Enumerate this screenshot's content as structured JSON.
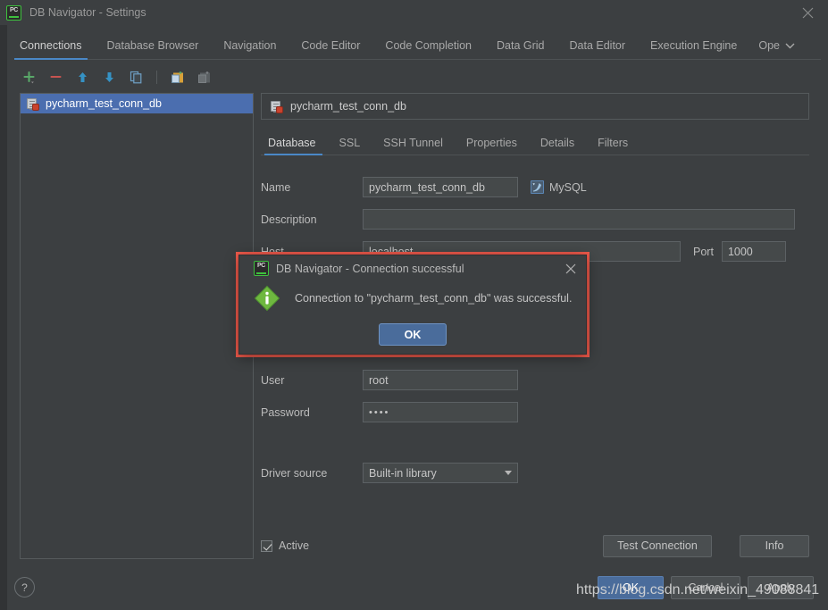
{
  "window": {
    "title": "DB Navigator - Settings",
    "logo_icon": "pycharm-pc-logo",
    "logo_text": "PC",
    "close_icon": "close-icon"
  },
  "tabs": [
    {
      "label": "Connections",
      "active": true
    },
    {
      "label": "Database Browser",
      "active": false
    },
    {
      "label": "Navigation",
      "active": false
    },
    {
      "label": "Code Editor",
      "active": false
    },
    {
      "label": "Code Completion",
      "active": false
    },
    {
      "label": "Data Grid",
      "active": false
    },
    {
      "label": "Data Editor",
      "active": false
    },
    {
      "label": "Execution Engine",
      "active": false
    },
    {
      "label": "Ope",
      "active": false
    }
  ],
  "tabs_overflow_icon": "chevron-down-icon",
  "toolbar": {
    "buttons": [
      {
        "name": "add-connection-button",
        "icon": "plus-icon"
      },
      {
        "name": "remove-connection-button",
        "icon": "minus-icon"
      },
      {
        "name": "move-up-button",
        "icon": "arrow-up-icon"
      },
      {
        "name": "move-down-button",
        "icon": "arrow-down-icon"
      },
      {
        "name": "copy-button",
        "icon": "copy-icon"
      },
      {
        "name": "paste-button",
        "icon": "paste-icon"
      },
      {
        "name": "import-button",
        "icon": "import-icon"
      }
    ]
  },
  "tree": {
    "items": [
      {
        "label": "pycharm_test_conn_db",
        "icon": "database-icon",
        "selected": true
      }
    ]
  },
  "connection": {
    "header_title": "pycharm_test_conn_db",
    "header_icon": "database-icon",
    "subtabs": [
      {
        "label": "Database",
        "active": true
      },
      {
        "label": "SSL",
        "active": false
      },
      {
        "label": "SSH Tunnel",
        "active": false
      },
      {
        "label": "Properties",
        "active": false
      },
      {
        "label": "Details",
        "active": false
      },
      {
        "label": "Filters",
        "active": false
      }
    ],
    "fields": {
      "name_label": "Name",
      "name_value": "pycharm_test_conn_db",
      "db_type_icon": "mysql-icon",
      "db_type_label": "MySQL",
      "description_label": "Description",
      "description_value": "",
      "description_placeholder": "",
      "host_label": "Host",
      "host_value": "localhost",
      "port_label": "Port",
      "port_value": "1000",
      "user_label": "User",
      "user_value": "root",
      "password_label": "Password",
      "password_value": "••••",
      "driver_source_label": "Driver source",
      "driver_source_value": "Built-in library",
      "driver_source_caret": "chevron-down-icon"
    },
    "active_checkbox_label": "Active",
    "active_checked": true,
    "test_connection_label": "Test Connection",
    "info_label": "Info"
  },
  "footer": {
    "help_label": "?",
    "ok_label": "OK",
    "cancel_label": "Cancel",
    "apply_label": "Apply"
  },
  "dialog": {
    "logo_text": "PC",
    "logo_icon": "pycharm-pc-logo",
    "title": "DB Navigator - Connection successful",
    "close_icon": "close-icon",
    "info_icon": "info-diamond-icon",
    "message": "Connection to \"pycharm_test_conn_db\" was successful.",
    "ok_label": "OK"
  },
  "watermark": {
    "text": "https://blog.csdn.net/weixin_49088841"
  },
  "colors": {
    "accent_blue": "#4a88c7",
    "selection_blue": "#4b6eaf",
    "primary_button": "#4a6c9b",
    "annotation_red": "#f05a4b",
    "success_green": "#6eb83f",
    "panel_bg": "#3c3f41",
    "field_bg": "#45494a"
  }
}
